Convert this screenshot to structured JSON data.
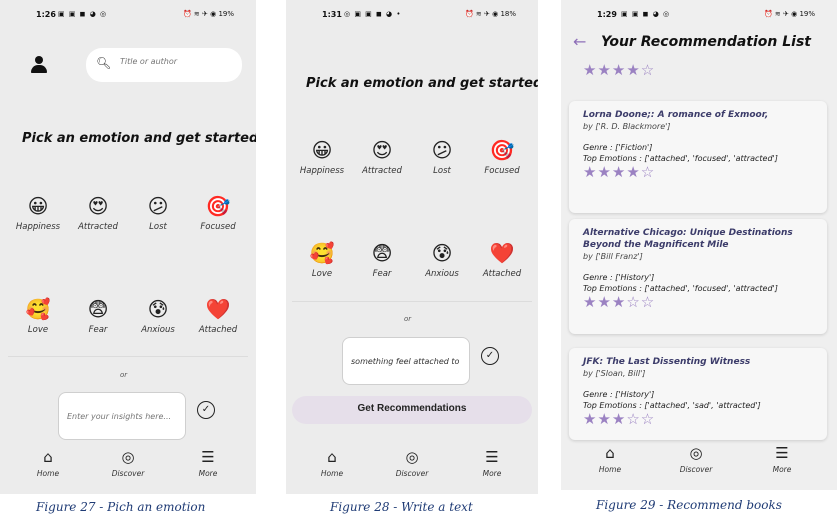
{
  "screen1": {
    "status": {
      "time": "1:26",
      "apps": "▣ ▣ ◼ ◕ ◎",
      "right": "⏰ ≋ ✈ ◉ 19%"
    },
    "search_placeholder": "Title or author",
    "heading": "Pick an emotion and get started",
    "emotions": [
      {
        "label": "Happiness",
        "emoji": "😀"
      },
      {
        "label": "Attracted",
        "emoji": "😍"
      },
      {
        "label": "Lost",
        "emoji": "😕"
      },
      {
        "label": "Focused",
        "emoji": "🎯"
      },
      {
        "label": "Love",
        "emoji": "🥰"
      },
      {
        "label": "Fear",
        "emoji": "😨"
      },
      {
        "label": "Anxious",
        "emoji": "😰"
      },
      {
        "label": "Attached",
        "emoji": "❤️"
      }
    ],
    "or": "or",
    "input_placeholder": "Enter your insights here...",
    "nav": [
      "Home",
      "Discover",
      "More"
    ],
    "caption": "Figure 27 - Pich an emotion"
  },
  "screen2": {
    "status": {
      "time": "1:31",
      "apps": "◎ ▣ ▣ ◼ ◕ •",
      "right": "⏰ ≋ ✈ ◉ 18%"
    },
    "heading": "Pick an emotion and get started",
    "or": "or",
    "input_value": "something feel attached to",
    "button": "Get Recommendations",
    "nav": [
      "Home",
      "Discover",
      "More"
    ],
    "caption": "Figure 28 - Write a text"
  },
  "screen3": {
    "status": {
      "time": "1:29",
      "apps": "▣ ▣ ◼ ◕ ◎",
      "right": "⏰ ≋ ✈ ◉ 19%"
    },
    "title": "Your Recommendation List",
    "books": [
      {
        "title": "Lorna Doone;: A romance of Exmoor,",
        "author": "by ['R. D. Blackmore']",
        "genre": "Genre : ['Fiction']",
        "emotions": "Top Emotions : ['attached', 'focused', 'attracted']",
        "rating": 4
      },
      {
        "title": "Alternative Chicago: Unique Destinations Beyond the Magnificent Mile",
        "author": "by ['Bill Franz']",
        "genre": "Genre : ['History']",
        "emotions": "Top Emotions : ['attached', 'focused', 'attracted']",
        "rating": 3
      },
      {
        "title": "JFK: The Last Dissenting Witness",
        "author": "by ['Sloan, Bill']",
        "genre": "Genre : ['History']",
        "emotions": "Top Emotions : ['attached', 'sad', 'attracted']",
        "rating": 3
      }
    ],
    "top_rating": 4,
    "nav": [
      "Home",
      "Discover",
      "More"
    ],
    "caption": "Figure 29 - Recommend books"
  },
  "colors": {
    "accent": "#9b82c2",
    "caption": "#1f3b75",
    "button": "#e6dfea"
  }
}
